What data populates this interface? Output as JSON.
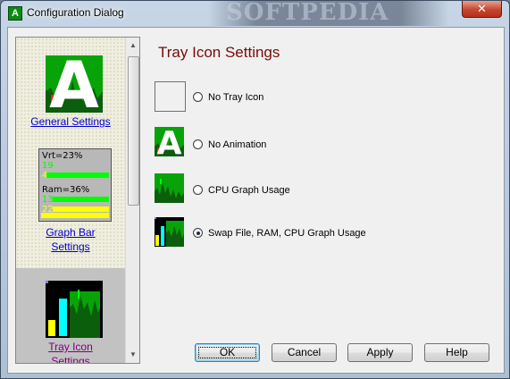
{
  "window": {
    "title": "Configuration Dialog",
    "app_icon_letter": "A",
    "watermark": "SOFTPEDIA",
    "close_glyph": "✕"
  },
  "sidebar": {
    "items": [
      {
        "label": "General Settings",
        "icon": "green-a-icon"
      },
      {
        "label": "Graph Bar Settings",
        "label_lines": [
          "Graph Bar",
          "Settings"
        ],
        "icon": "graph-bar-preview-icon",
        "preview": {
          "vrt": "Vrt=23%",
          "vrt_green": "19",
          "vrt_yellow": "4",
          "ram": "Ram=36%",
          "ram_green": "13",
          "ram_yellow": "22"
        }
      },
      {
        "label": "Tray Icon Settings",
        "label_lines": [
          "Tray Icon",
          "Settings"
        ],
        "icon": "tray-bars-icon",
        "selected": true
      }
    ]
  },
  "main": {
    "title": "Tray Icon Settings",
    "options": [
      {
        "label": "No Tray Icon",
        "icon": "blank-icon",
        "checked": false
      },
      {
        "label": "No Animation",
        "icon": "green-a-icon",
        "checked": false
      },
      {
        "label": "CPU Graph Usage",
        "icon": "cpu-graph-icon",
        "checked": false
      },
      {
        "label": "Swap File, RAM, CPU Graph Usage",
        "icon": "swap-ram-cpu-icon",
        "checked": true
      }
    ]
  },
  "buttons": {
    "ok": "OK",
    "cancel": "Cancel",
    "apply": "Apply",
    "help": "Help"
  },
  "colors": {
    "title_accent": "#7a0a0a",
    "link": "#0000cc",
    "visited_link": "#800080",
    "graph_green": "#08a308"
  }
}
